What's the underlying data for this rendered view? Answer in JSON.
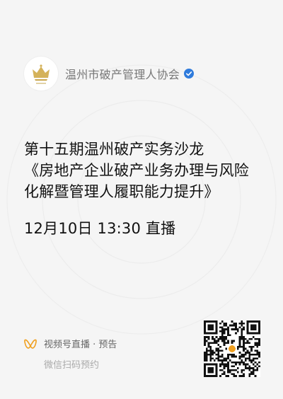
{
  "header": {
    "account_name": "温州市破产管理人协会",
    "logo_icon": "crown-logo-icon",
    "verified_icon": "verified-check-icon",
    "verified_color": "#2f7bdc"
  },
  "event": {
    "title_lines": [
      "第十五期温州破产实务沙龙",
      "《房地产企业破产业务办理与风险",
      "化解暨管理人履职能力提升》"
    ],
    "schedule": "12月10日 13:30 直播"
  },
  "footer": {
    "channel_icon": "wechat-channels-icon",
    "channel_label": "视频号直播 · 预告",
    "instruction": "微信扫码预约",
    "accent_color": "#f0a020"
  },
  "qr": {
    "icon": "qr-code-icon"
  }
}
